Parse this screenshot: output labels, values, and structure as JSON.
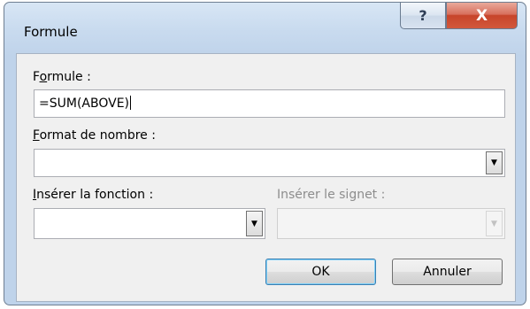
{
  "window": {
    "title": "Formule",
    "help_glyph": "?",
    "close_glyph": "X"
  },
  "formula": {
    "label_pre": "F",
    "label_mnemonic": "o",
    "label_post": "rmule :",
    "value": "=SUM(ABOVE)"
  },
  "number_format": {
    "label_mnemonic": "F",
    "label_post": "ormat de nombre :",
    "value": ""
  },
  "insert_function": {
    "label_mnemonic": "I",
    "label_post": "nsérer la fonction :",
    "value": ""
  },
  "insert_bookmark": {
    "label": "Insérer le signet :",
    "value": "",
    "enabled": false
  },
  "buttons": {
    "ok": "OK",
    "cancel": "Annuler"
  },
  "icons": {
    "dropdown": "chevron-down-icon",
    "help": "help-icon",
    "close": "close-icon"
  }
}
